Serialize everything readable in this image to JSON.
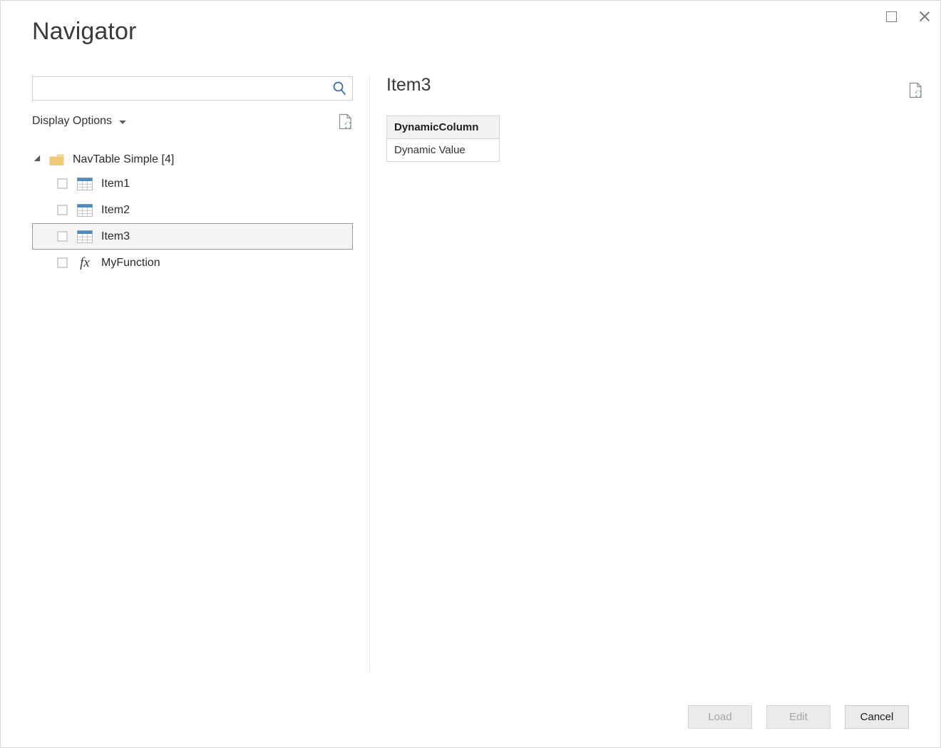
{
  "window": {
    "title": "Navigator",
    "controls": [
      {
        "name": "maximize-button",
        "icon": "maximize-icon",
        "label": "Maximize"
      },
      {
        "name": "close-button",
        "icon": "close-icon",
        "label": "Close"
      }
    ]
  },
  "search": {
    "value": "",
    "placeholder": "",
    "icon": "search-icon"
  },
  "display_options": {
    "label": "Display Options",
    "caret_icon": "chevron-down-icon",
    "refresh_icon": "refresh-document-icon"
  },
  "tree": {
    "root": {
      "label": "NavTable Simple [4]",
      "icon": "folder-icon",
      "expanded": true,
      "expander_icon": "triangle-expanded-icon"
    },
    "items": [
      {
        "label": "Item1",
        "icon": "table-icon",
        "checked": false,
        "selected": false
      },
      {
        "label": "Item2",
        "icon": "table-icon",
        "checked": false,
        "selected": false
      },
      {
        "label": "Item3",
        "icon": "table-icon",
        "checked": false,
        "selected": true
      },
      {
        "label": "MyFunction",
        "icon": "function-icon",
        "checked": false,
        "selected": false
      }
    ]
  },
  "preview": {
    "title": "Item3",
    "refresh_icon": "refresh-document-icon",
    "table": {
      "columns": [
        "DynamicColumn"
      ],
      "rows": [
        [
          "Dynamic Value"
        ]
      ]
    }
  },
  "footer": {
    "buttons": [
      {
        "label": "Load",
        "name": "load-button",
        "disabled": true
      },
      {
        "label": "Edit",
        "name": "edit-button",
        "disabled": true
      },
      {
        "label": "Cancel",
        "name": "cancel-button",
        "disabled": false
      }
    ]
  },
  "colors": {
    "accent_blue": "#2e6da4",
    "folder_gold": "#efc87a",
    "table_header_blue": "#4a8bc2",
    "refresh_green": "#5f9e7d",
    "selection_bg": "#f4f4f4",
    "selection_border": "#9a9a9a"
  }
}
